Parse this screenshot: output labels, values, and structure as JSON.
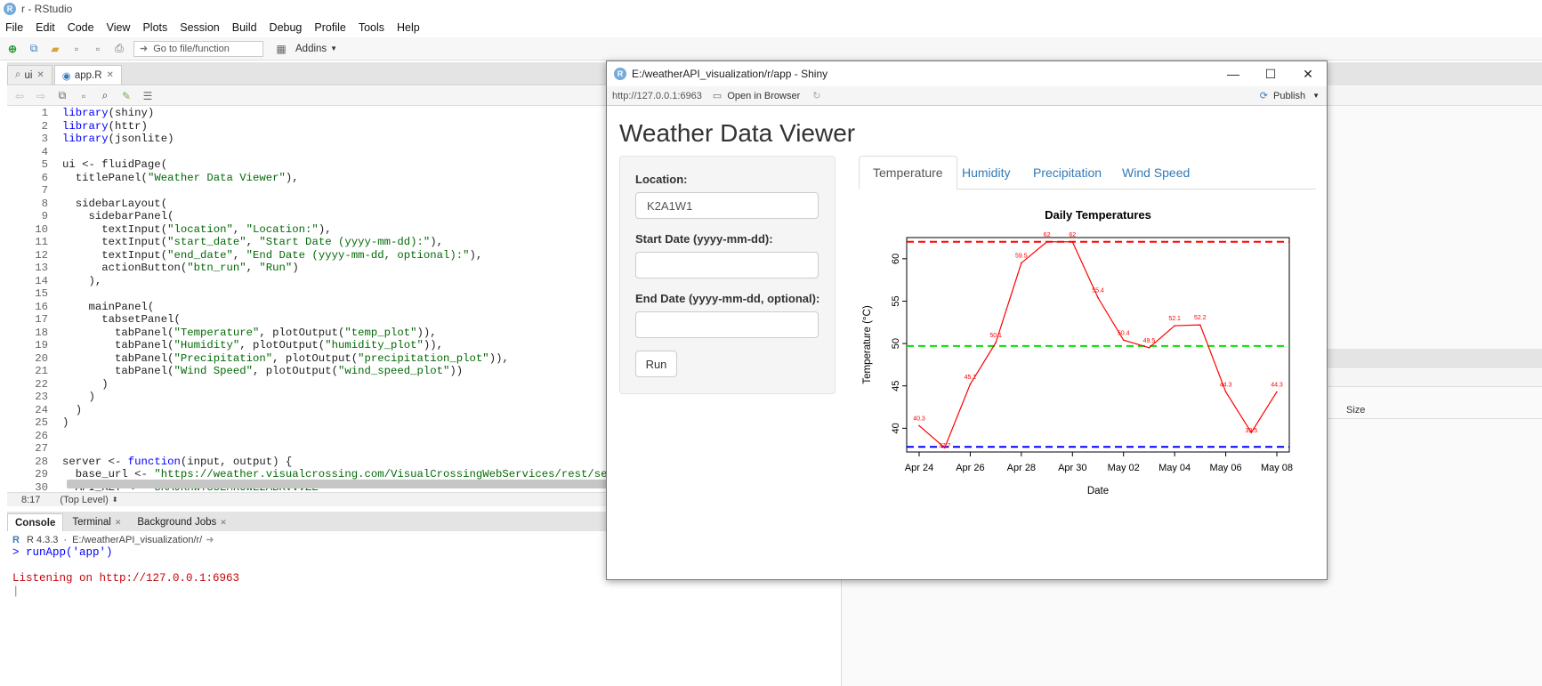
{
  "window": {
    "title": "r - RStudio"
  },
  "menu": [
    "File",
    "Edit",
    "Code",
    "View",
    "Plots",
    "Session",
    "Build",
    "Debug",
    "Profile",
    "Tools",
    "Help"
  ],
  "toolbar": {
    "goto_placeholder": "Go to file/function",
    "addins_label": "Addins"
  },
  "editor_tabs": [
    {
      "label": "ui",
      "active": false
    },
    {
      "label": "app.R",
      "active": true
    }
  ],
  "code_lines": [
    {
      "n": "1",
      "t": "library(shiny)"
    },
    {
      "n": "2",
      "t": "library(httr)"
    },
    {
      "n": "3",
      "t": "library(jsonlite)"
    },
    {
      "n": "4",
      "t": ""
    },
    {
      "n": "5",
      "t": "ui <- fluidPage("
    },
    {
      "n": "6",
      "t": "  titlePanel(\"Weather Data Viewer\"),"
    },
    {
      "n": "7",
      "t": ""
    },
    {
      "n": "8",
      "t": "  sidebarLayout("
    },
    {
      "n": "9",
      "t": "    sidebarPanel("
    },
    {
      "n": "10",
      "t": "      textInput(\"location\", \"Location:\"),"
    },
    {
      "n": "11",
      "t": "      textInput(\"start_date\", \"Start Date (yyyy-mm-dd):\"),"
    },
    {
      "n": "12",
      "t": "      textInput(\"end_date\", \"End Date (yyyy-mm-dd, optional):\"),"
    },
    {
      "n": "13",
      "t": "      actionButton(\"btn_run\", \"Run\")"
    },
    {
      "n": "14",
      "t": "    ),"
    },
    {
      "n": "15",
      "t": ""
    },
    {
      "n": "16",
      "t": "    mainPanel("
    },
    {
      "n": "17",
      "t": "      tabsetPanel("
    },
    {
      "n": "18",
      "t": "        tabPanel(\"Temperature\", plotOutput(\"temp_plot\")),"
    },
    {
      "n": "19",
      "t": "        tabPanel(\"Humidity\", plotOutput(\"humidity_plot\")),"
    },
    {
      "n": "20",
      "t": "        tabPanel(\"Precipitation\", plotOutput(\"precipitation_plot\")),"
    },
    {
      "n": "21",
      "t": "        tabPanel(\"Wind Speed\", plotOutput(\"wind_speed_plot\"))"
    },
    {
      "n": "22",
      "t": "      )"
    },
    {
      "n": "23",
      "t": "    )"
    },
    {
      "n": "24",
      "t": "  )"
    },
    {
      "n": "25",
      "t": ")"
    },
    {
      "n": "26",
      "t": ""
    },
    {
      "n": "27",
      "t": ""
    },
    {
      "n": "28",
      "t": "server <- function(input, output) {"
    },
    {
      "n": "29",
      "t": "  base_url <- \"https://weather.visualcrossing.com/VisualCrossingWebServices/rest/serv"
    },
    {
      "n": "30",
      "t": "  API_KEY <- \"3KAJKHWT3UEMROWE2ABKVVVZE\""
    },
    {
      "n": "31",
      "t": ""
    }
  ],
  "status": {
    "position": "8:17",
    "scope": "(Top Level)"
  },
  "console_tabs": [
    {
      "label": "Console",
      "active": true
    },
    {
      "label": "Terminal",
      "active": false
    },
    {
      "label": "Background Jobs",
      "active": false
    }
  ],
  "console": {
    "r_version": "R 4.3.3",
    "path": "E:/weatherAPI_visualization/r/",
    "command": "> runApp('app')",
    "output": "Listening on http://127.0.0.1:6963"
  },
  "right_pane": {
    "column_label": "Size"
  },
  "shiny": {
    "title": "E:/weatherAPI_visualization/r/app - Shiny",
    "url": "http://127.0.0.1:6963",
    "open_browser": "Open in Browser",
    "publish": "Publish",
    "app_title": "Weather Data Viewer",
    "location_label": "Location:",
    "location_value": "K2A1W1",
    "start_label": "Start Date (yyyy-mm-dd):",
    "start_value": "",
    "end_label": "End Date (yyyy-mm-dd, optional):",
    "end_value": "",
    "run_label": "Run",
    "tabs": [
      {
        "label": "Temperature",
        "active": true
      },
      {
        "label": "Humidity",
        "active": false
      },
      {
        "label": "Precipitation",
        "active": false
      },
      {
        "label": "Wind Speed",
        "active": false
      }
    ]
  },
  "chart_data": {
    "type": "line",
    "title": "Daily Temperatures",
    "xlabel": "Date",
    "ylabel": "Temperature (°C)",
    "x": [
      "Apr 24",
      "Apr 25",
      "Apr 26",
      "Apr 27",
      "Apr 28",
      "Apr 29",
      "Apr 30",
      "May 01",
      "May 02",
      "May 03",
      "May 04",
      "May 05",
      "May 06",
      "May 07",
      "May 08"
    ],
    "values": [
      40.3,
      37.7,
      45.2,
      50.1,
      59.5,
      62.0,
      62.0,
      55.4,
      50.4,
      49.5,
      52.1,
      52.2,
      44.3,
      39.5,
      44.3
    ],
    "point_labels": [
      "40.3",
      "37.7",
      "45.2",
      "50.1",
      "59.5",
      "62",
      "62",
      "55.4",
      "50.4",
      "49.5",
      "52.1",
      "52.2",
      "44.3",
      "39.5",
      "44.3"
    ],
    "x_ticks": [
      "Apr 24",
      "Apr 26",
      "Apr 28",
      "Apr 30",
      "May 02",
      "May 04",
      "May 06",
      "May 08"
    ],
    "y_ticks": [
      40,
      45,
      50,
      55,
      60
    ],
    "ylim": [
      37.2,
      62.5
    ],
    "reference_lines": [
      {
        "value": 62.0,
        "color": "#ff0000"
      },
      {
        "value": 49.7,
        "color": "#00e000"
      },
      {
        "value": 37.8,
        "color": "#0000ff"
      }
    ],
    "line_color": "#ff0000"
  }
}
